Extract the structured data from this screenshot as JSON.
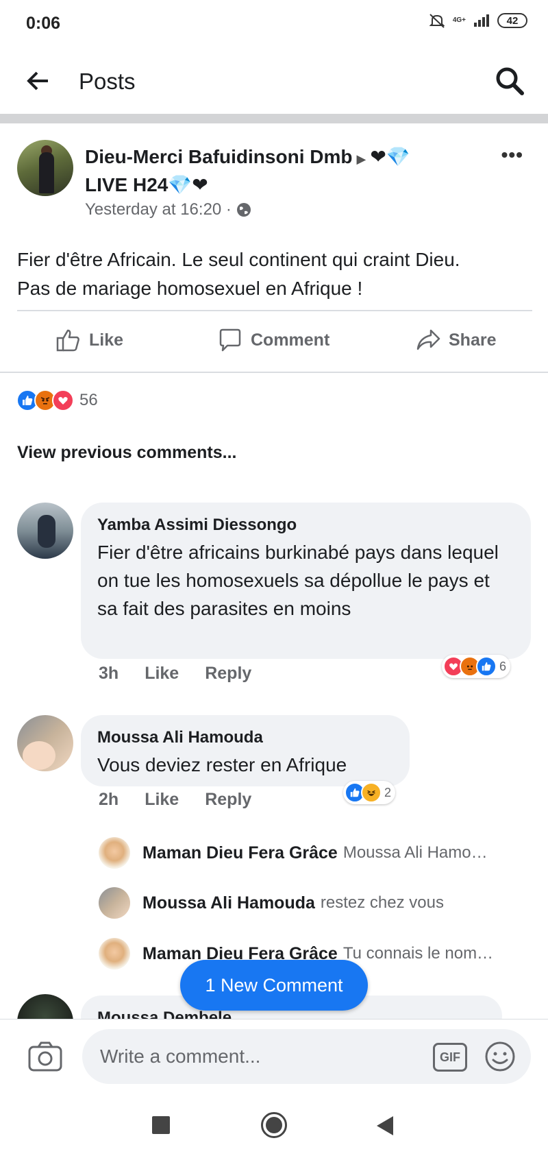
{
  "status_bar": {
    "time": "0:06",
    "network": "4G+",
    "battery": "42"
  },
  "app_bar": {
    "title": "Posts"
  },
  "post": {
    "author_line1": "Dieu-Merci Bafuidinsoni Dmb",
    "author_line1_emoji": "❤💎",
    "author_line2": "LIVE H24",
    "author_line2_emoji": "💎❤",
    "timestamp": "Yesterday at 16:20 ·",
    "text_line1": "Fier d'être Africain. Le seul continent qui craint Dieu.",
    "text_line2": "Pas de mariage homosexuel en Afrique !",
    "reaction_count": "56"
  },
  "actions": {
    "like": "Like",
    "comment": "Comment",
    "share": "Share"
  },
  "view_previous": "View previous comments...",
  "comments": [
    {
      "name": "Yamba Assimi Diessongo",
      "text": "Fier d'être africains burkinabé pays dans lequel on tue les homosexuels sa dépollue le pays et sa fait des parasites en moins",
      "time": "3h",
      "like": "Like",
      "reply": "Reply",
      "reaction_count": "6"
    },
    {
      "name": "Moussa Ali Hamouda",
      "text": "Vous deviez rester en Afrique",
      "time": "2h",
      "like": "Like",
      "reply": "Reply",
      "reaction_count": "2"
    },
    {
      "name": "Moussa Dembele"
    }
  ],
  "replies": [
    {
      "name": "Maman Dieu Fera Grâce",
      "snippet": "Moussa Ali Hamo…"
    },
    {
      "name": "Moussa Ali Hamouda",
      "snippet": "restez chez vous"
    },
    {
      "name": "Maman Dieu Fera Grâce",
      "snippet": "Tu connais le nom…"
    }
  ],
  "new_comment_pill": "1 New Comment",
  "composer": {
    "placeholder": "Write a comment...",
    "gif": "GIF"
  },
  "colors": {
    "accent": "#1877f2",
    "like": "#1877f2",
    "angry": "#e9710f",
    "love": "#f33e58",
    "haha": "#f7b125"
  },
  "icons": [
    "back-arrow-icon",
    "search-icon",
    "more-icon",
    "globe-icon",
    "like-icon",
    "comment-icon",
    "share-icon",
    "camera-icon",
    "gif-icon",
    "emoji-icon"
  ]
}
